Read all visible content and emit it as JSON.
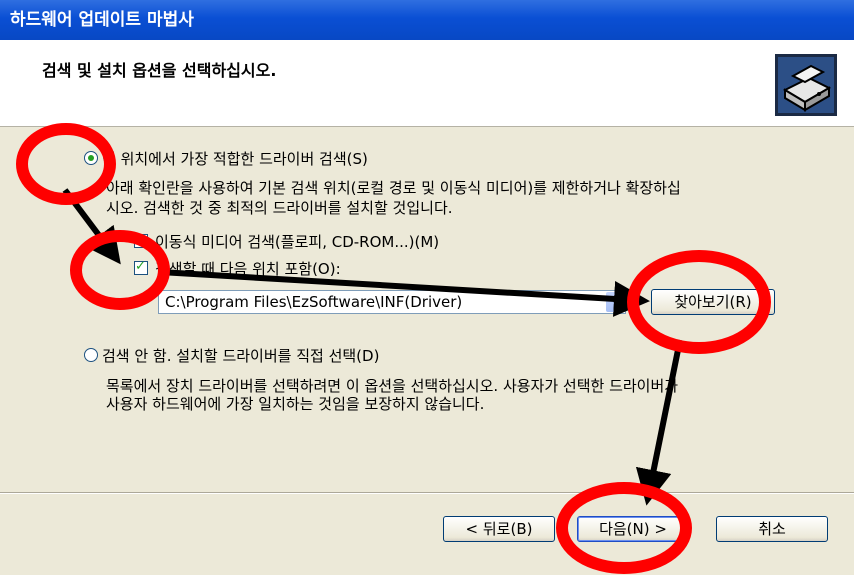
{
  "window": {
    "title": "하드웨어 업데이트 마법사"
  },
  "header": {
    "title": "검색 및 설치 옵션을 선택하십시오."
  },
  "option_search": {
    "label": "이 위치에서 가장 적합한 드라이버 검색(S)",
    "selected": true,
    "description_line1": "아래 확인란을 사용하여 기본 검색 위치(로컬 경로 및 이동식 미디어)를 제한하거나 확장하십",
    "description_line2": "시오. 검색한 것 중 최적의 드라이버를 설치할 것입니다."
  },
  "check_removable": {
    "label": "이동식 미디어 검색(플로피, CD-ROM...)(M)",
    "checked": false
  },
  "check_include": {
    "label": "검색할 때 다음 위치 포함(O):",
    "checked": true
  },
  "path_combo": {
    "value": "C:\\Program Files\\EzSoftware\\INF(Driver)"
  },
  "browse_button": {
    "label": "찾아보기(R)"
  },
  "option_manual": {
    "label": "검색 안 함. 설치할 드라이버를 직접 선택(D)",
    "selected": false,
    "description_line1": "목록에서 장치 드라이버를 선택하려면 이 옵션을 선택하십시오. 사용자가 선택한 드라이버가",
    "description_line2": "사용자 하드웨어에 가장 일치하는 것임을 보장하지 않습니다."
  },
  "footer": {
    "back_label": "< 뒤로(B)",
    "next_label": "다음(N) >",
    "cancel_label": "취소"
  },
  "colors": {
    "titlebar": "#0a4fd4",
    "dialog_bg": "#ece9d8",
    "annotation": "#ff0000",
    "arrow": "#000000"
  }
}
